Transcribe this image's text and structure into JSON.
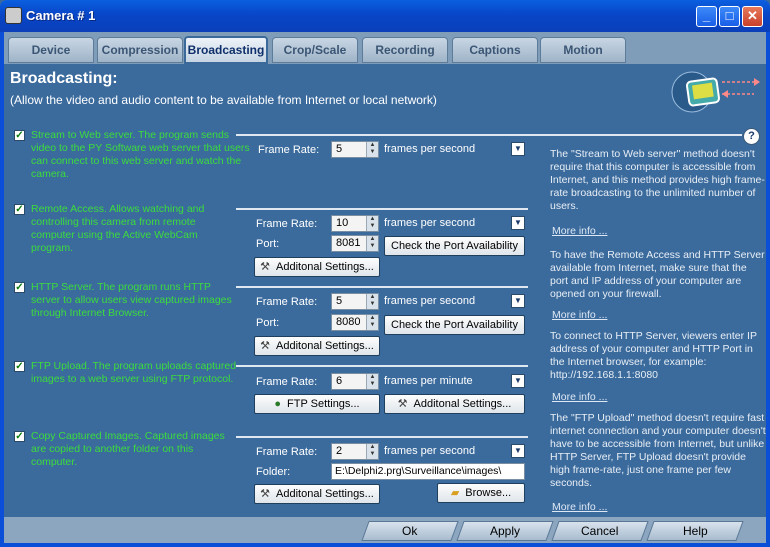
{
  "window": {
    "title": "Camera # 1",
    "min": "_",
    "max": "□",
    "close": "✕"
  },
  "tabs": [
    "Device",
    "Compression",
    "Broadcasting",
    "Crop/Scale",
    "Recording",
    "Captions",
    "Motion"
  ],
  "header": {
    "title": "Broadcasting:",
    "subtitle": "(Allow the video and audio content to be available from Internet or local network)"
  },
  "sections": {
    "web": {
      "desc": "Stream to Web server. The program sends video to the PY Software web server that users can connect to this web server and watch the camera.",
      "frame_rate_label": "Frame Rate:",
      "frame_rate": "5",
      "unit": "frames per second"
    },
    "remote": {
      "desc": "Remote Access. Allows watching and controlling this camera from remote computer using the Active WebCam program.",
      "frame_rate_label": "Frame Rate:",
      "frame_rate": "10",
      "unit": "frames per second",
      "port_label": "Port:",
      "port": "8081",
      "check_port": "Check the Port Availability",
      "additional": "Additonal Settings..."
    },
    "http": {
      "desc": "HTTP Server. The program runs HTTP server to allow users view captured images through Internet Browser.",
      "frame_rate_label": "Frame Rate:",
      "frame_rate": "5",
      "unit": "frames per second",
      "port_label": "Port:",
      "port": "8080",
      "check_port": "Check the Port Availability",
      "additional": "Additonal Settings..."
    },
    "ftp": {
      "desc": "FTP Upload. The program uploads captured images to a web server using FTP protocol.",
      "frame_rate_label": "Frame Rate:",
      "frame_rate": "6",
      "unit": "frames per minute",
      "ftp_settings": "FTP Settings...",
      "additional": "Additonal Settings..."
    },
    "copy": {
      "desc": "Copy Captured Images. Captured images are copied to another folder on this computer.",
      "frame_rate_label": "Frame Rate:",
      "frame_rate": "2",
      "unit": "frames per second",
      "folder_label": "Folder:",
      "folder": "E:\\Delphi2.prg\\Surveillance\\images\\",
      "additional": "Additonal Settings...",
      "browse": "Browse..."
    }
  },
  "info": {
    "help": "?",
    "p1": "The \"Stream to Web server\" method doesn't require that this computer is accessible from Internet, and this method provides high frame-rate broadcasting to the unlimited number of users.",
    "p2": "To have the Remote Access and HTTP Server available from Internet, make sure that the port and IP address of your computer are opened on your firewall.",
    "p3": "To connect to HTTP Server, viewers enter IP address of your computer and HTTP Port in the Internet browser, for example: http://192.168.1.1:8080",
    "p4": "The \"FTP Upload\" method doesn't require fast internet connection and your computer doesn't have to be accessible from Internet, but unlike HTTP Server, FTP Upload doesn't provide high frame-rate, just one frame per few seconds.",
    "more": "More info ..."
  },
  "footer": {
    "ok": "Ok",
    "apply": "Apply",
    "cancel": "Cancel",
    "help": "Help"
  }
}
